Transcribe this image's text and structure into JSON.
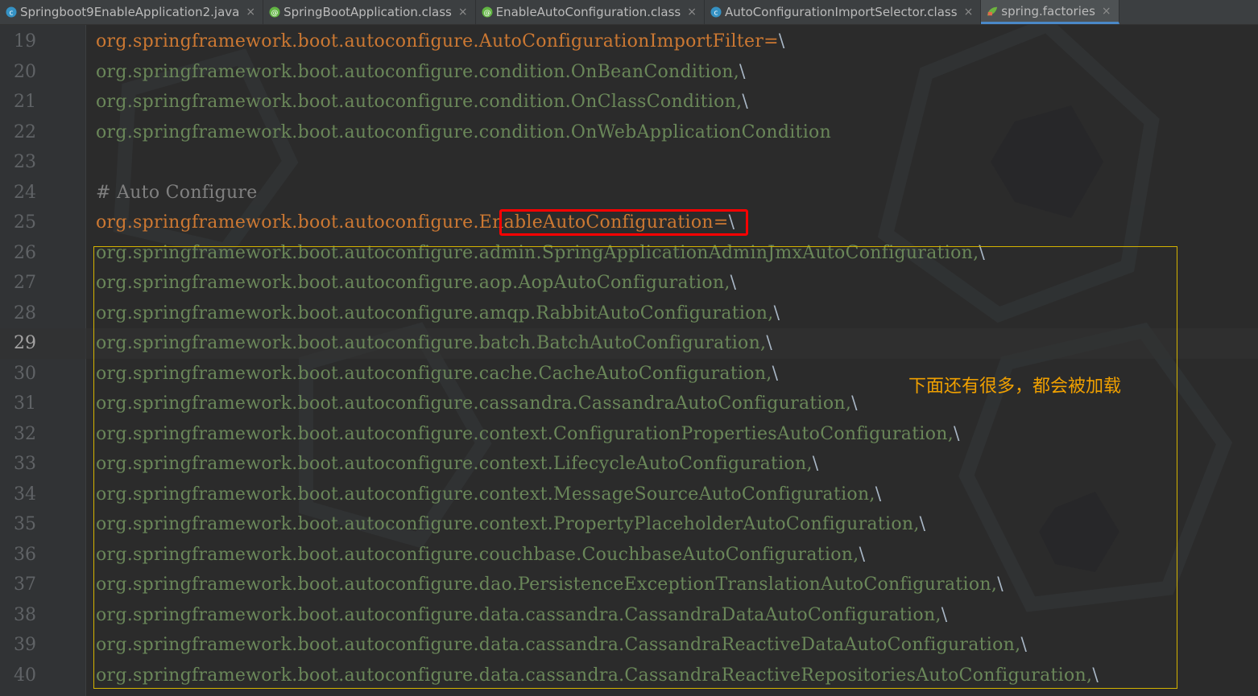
{
  "tabs": [
    {
      "label": "Springboot9EnableApplication2.java",
      "icon": "java-class-icon",
      "active": false
    },
    {
      "label": "SpringBootApplication.class",
      "icon": "annotation-class-icon",
      "active": false
    },
    {
      "label": "EnableAutoConfiguration.class",
      "icon": "annotation-class-icon",
      "active": false
    },
    {
      "label": "AutoConfigurationImportSelector.class",
      "icon": "class-icon",
      "active": false
    },
    {
      "label": "spring.factories",
      "icon": "spring-leaf-icon",
      "active": true
    }
  ],
  "tab_close_glyph": "×",
  "lines": [
    {
      "num": "19",
      "prefix": "org.springframework.boot.autoconfigure.AutoConfigurationImportFilter=",
      "suffix": "\\",
      "kind": "key"
    },
    {
      "num": "20",
      "prefix": "org.springframework.boot.autoconfigure.condition.OnBeanCondition,",
      "suffix": "\\",
      "kind": "val"
    },
    {
      "num": "21",
      "prefix": "org.springframework.boot.autoconfigure.condition.OnClassCondition,",
      "suffix": "\\",
      "kind": "val"
    },
    {
      "num": "22",
      "prefix": "org.springframework.boot.autoconfigure.condition.OnWebApplicationCondition",
      "suffix": "",
      "kind": "val"
    },
    {
      "num": "23",
      "prefix": "",
      "suffix": "",
      "kind": "val"
    },
    {
      "num": "24",
      "prefix": "# Auto Configure",
      "suffix": "",
      "kind": "comment"
    },
    {
      "num": "25",
      "prefix": "org.springframework.boot.autoconfigure.EnableAutoConfiguration=",
      "suffix": "\\",
      "kind": "key"
    },
    {
      "num": "26",
      "prefix": "org.springframework.boot.autoconfigure.admin.SpringApplicationAdminJmxAutoConfiguration,",
      "suffix": "\\",
      "kind": "val"
    },
    {
      "num": "27",
      "prefix": "org.springframework.boot.autoconfigure.aop.AopAutoConfiguration,",
      "suffix": "\\",
      "kind": "val"
    },
    {
      "num": "28",
      "prefix": "org.springframework.boot.autoconfigure.amqp.RabbitAutoConfiguration,",
      "suffix": "\\",
      "kind": "val"
    },
    {
      "num": "29",
      "prefix": "org.springframework.boot.autoconfigure.batch.BatchAutoConfiguration,",
      "suffix": "\\",
      "kind": "val",
      "current": true
    },
    {
      "num": "30",
      "prefix": "org.springframework.boot.autoconfigure.cache.CacheAutoConfiguration,",
      "suffix": "\\",
      "kind": "val"
    },
    {
      "num": "31",
      "prefix": "org.springframework.boot.autoconfigure.cassandra.CassandraAutoConfiguration,",
      "suffix": "\\",
      "kind": "val"
    },
    {
      "num": "32",
      "prefix": "org.springframework.boot.autoconfigure.context.ConfigurationPropertiesAutoConfiguration,",
      "suffix": "\\",
      "kind": "val"
    },
    {
      "num": "33",
      "prefix": "org.springframework.boot.autoconfigure.context.LifecycleAutoConfiguration,",
      "suffix": "\\",
      "kind": "val"
    },
    {
      "num": "34",
      "prefix": "org.springframework.boot.autoconfigure.context.MessageSourceAutoConfiguration,",
      "suffix": "\\",
      "kind": "val"
    },
    {
      "num": "35",
      "prefix": "org.springframework.boot.autoconfigure.context.PropertyPlaceholderAutoConfiguration,",
      "suffix": "\\",
      "kind": "val"
    },
    {
      "num": "36",
      "prefix": "org.springframework.boot.autoconfigure.couchbase.CouchbaseAutoConfiguration,",
      "suffix": "\\",
      "kind": "val"
    },
    {
      "num": "37",
      "prefix": "org.springframework.boot.autoconfigure.dao.PersistenceExceptionTranslationAutoConfiguration,",
      "suffix": "\\",
      "kind": "val"
    },
    {
      "num": "38",
      "prefix": "org.springframework.boot.autoconfigure.data.cassandra.CassandraDataAutoConfiguration,",
      "suffix": "\\",
      "kind": "val"
    },
    {
      "num": "39",
      "prefix": "org.springframework.boot.autoconfigure.data.cassandra.CassandraReactiveDataAutoConfiguration,",
      "suffix": "\\",
      "kind": "val"
    },
    {
      "num": "40",
      "prefix": "org.springframework.boot.autoconfigure.data.cassandra.CassandraReactiveRepositoriesAutoConfiguration,",
      "suffix": "\\",
      "kind": "val"
    }
  ],
  "annotation_note": "下面还有很多，都会被加载",
  "colors": {
    "key": "#cc7832",
    "value": "#6a8759",
    "comment": "#808080",
    "highlight_red": "#ff0000",
    "highlight_yellow": "#d4b300",
    "note": "#f0a000"
  }
}
